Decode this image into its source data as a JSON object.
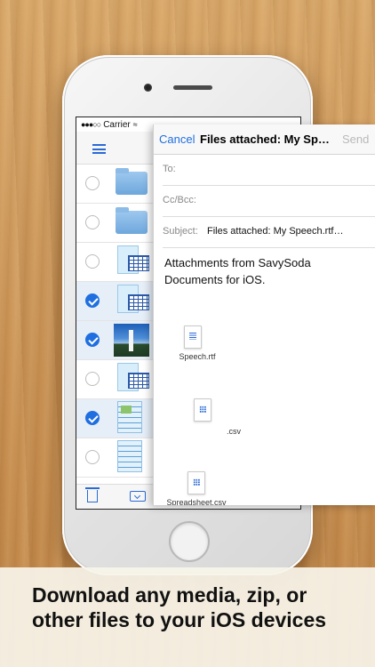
{
  "status_bar": {
    "signal": "●●●○○",
    "carrier": "Carrier",
    "wifi": "wifi-icon"
  },
  "file_list": {
    "rows": [
      {
        "selected": false,
        "kind": "folder"
      },
      {
        "selected": false,
        "kind": "folder"
      },
      {
        "selected": false,
        "kind": "spreadsheet"
      },
      {
        "selected": true,
        "kind": "spreadsheet"
      },
      {
        "selected": true,
        "kind": "photo"
      },
      {
        "selected": false,
        "kind": "spreadsheet"
      },
      {
        "selected": true,
        "kind": "image-document"
      },
      {
        "selected": false,
        "kind": "text-document"
      }
    ]
  },
  "mail": {
    "cancel_label": "Cancel",
    "title": "Files attached:  My Sp…",
    "send_label": "Send",
    "to_label": "To:",
    "cc_label": "Cc/Bcc:",
    "subject_label": "Subject:",
    "subject_value": "Files attached:  My Speech.rtf…",
    "body": "Attachments from SavySoda Documents for iOS.",
    "attachments": [
      {
        "name": "Speech.rtf",
        "icon": "document-icon"
      },
      {
        "name": ".csv",
        "icon": "spreadsheet-icon"
      },
      {
        "name": "Spreadsheet.csv",
        "icon": "spreadsheet-icon"
      }
    ]
  },
  "caption": "Download any media, zip, or other files to your iOS devices",
  "colors": {
    "accent": "#1f6fe0",
    "selected_row": "#e6eef8"
  }
}
